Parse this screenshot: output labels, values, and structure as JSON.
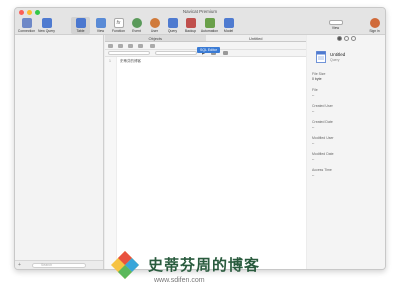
{
  "window": {
    "title": "Navicat Premium"
  },
  "toolbar": {
    "items": [
      {
        "label": "Connection",
        "color": "#6e88c7"
      },
      {
        "label": "New Query",
        "color": "#4f7bd0"
      },
      {
        "label": "Table",
        "color": "#4a77cf"
      },
      {
        "label": "View",
        "color": "#5a8bd6"
      },
      {
        "label": "Function",
        "color": "#777777"
      },
      {
        "label": "Event",
        "color": "#5a9a5a"
      },
      {
        "label": "User",
        "color": "#d07a3a"
      },
      {
        "label": "Query",
        "color": "#4f7bd0"
      },
      {
        "label": "Backup",
        "color": "#c0504d"
      },
      {
        "label": "Automation",
        "color": "#6aa04a"
      },
      {
        "label": "Model",
        "color": "#4f7bd0"
      },
      {
        "label": "View",
        "color": "#888888"
      },
      {
        "label": "Sign in",
        "color": "#d06a3a"
      }
    ]
  },
  "sidebar": {
    "search_placeholder": "Search",
    "add_glyph": "+"
  },
  "tabs": [
    {
      "label": "Objects"
    },
    {
      "label": "Untitled"
    }
  ],
  "editor": {
    "tooltip": "SQL Editor",
    "run_glyph": "▶",
    "line_number": "1",
    "code_text": "史蒂芬的博客"
  },
  "info_panel": {
    "name": "Untitled",
    "type": "Query",
    "fields": [
      {
        "label": "File Size",
        "value": "0 byte"
      },
      {
        "label": "File",
        "value": "--"
      },
      {
        "label": "Created User",
        "value": "--"
      },
      {
        "label": "Created Date",
        "value": "--"
      },
      {
        "label": "Modified User",
        "value": "--"
      },
      {
        "label": "Modified Date",
        "value": "--"
      },
      {
        "label": "Access Time",
        "value": "--"
      }
    ]
  },
  "watermark": {
    "title": "史蒂芬周的博客",
    "url": "www.sdifen.com"
  }
}
